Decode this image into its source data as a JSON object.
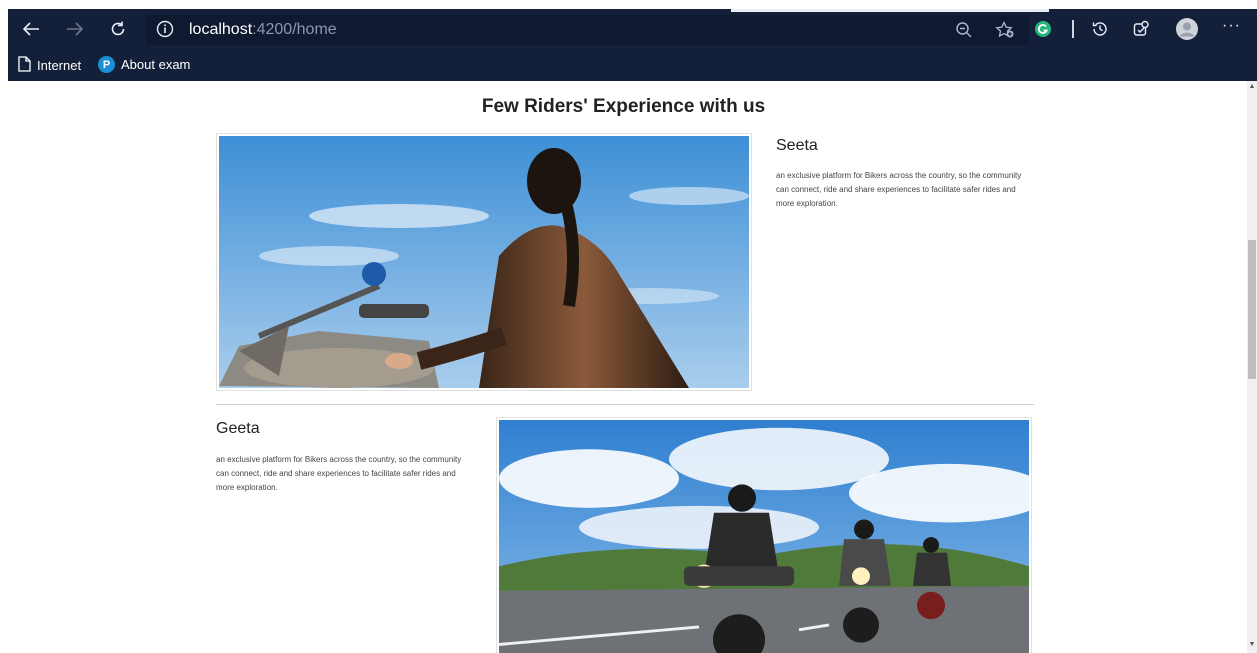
{
  "browser": {
    "url_host": "localhost",
    "url_rest": ":4200/home",
    "bookmarks": [
      {
        "label": "Internet",
        "icon": "page-icon"
      },
      {
        "label": "About exam",
        "icon": "pearson-logo-icon",
        "logo_letter": "P"
      }
    ],
    "menu_label": "···"
  },
  "page": {
    "heading": "Few Riders' Experience with us",
    "riders": [
      {
        "name": "Seeta",
        "description": "an exclusive platform for Bikers across the country, so the community can connect, ride and share experiences to facilitate safer rides and more exploration."
      },
      {
        "name": "Geeta",
        "description": "an exclusive platform for Bikers across the country, so the community can connect, ride and share experiences to facilitate safer rides and more exploration."
      }
    ]
  },
  "colors": {
    "chrome_bg": "#14203a",
    "address_bg": "#0f1a31",
    "accent_green": "#25b67a"
  }
}
